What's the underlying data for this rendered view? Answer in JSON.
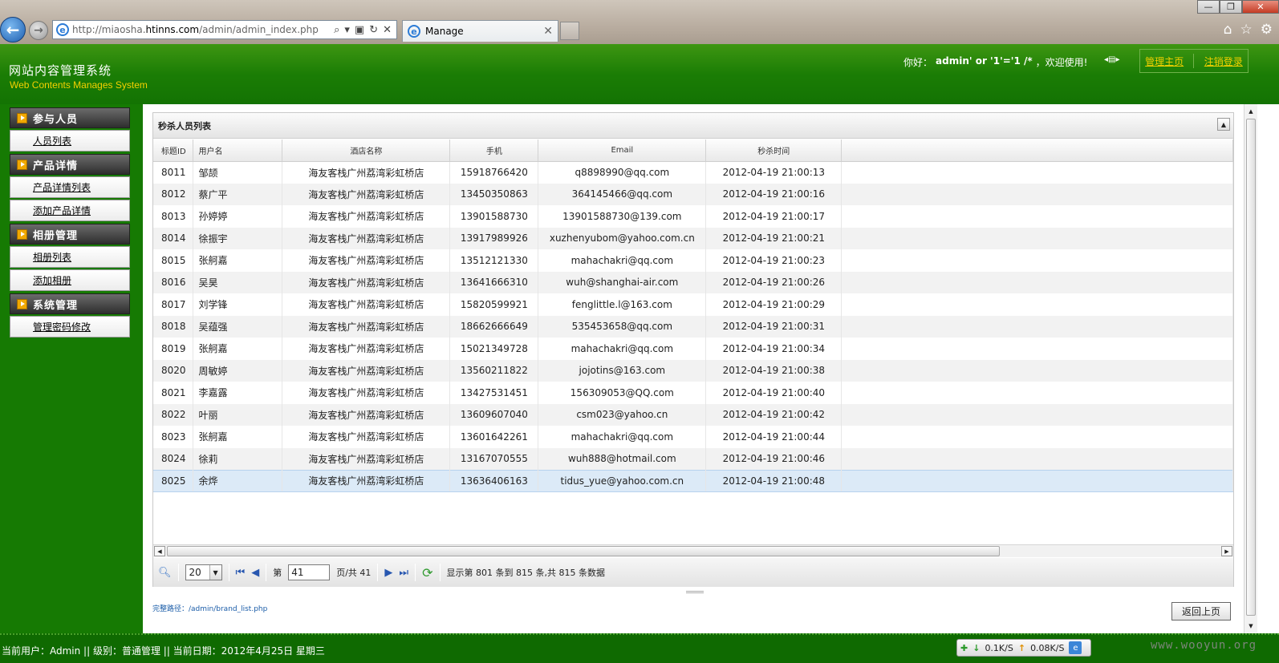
{
  "browser": {
    "url_prefix": "http://miaosha.",
    "url_domain": "htinns.com",
    "url_path": "/admin/admin_index.php",
    "tab_title": "Manage",
    "window_controls": [
      "—",
      "❐",
      "✕"
    ]
  },
  "header": {
    "title": "网站内容管理系统",
    "subtitle": "Web Contents Manages System",
    "greeting": "你好：",
    "username": "admin' or '1'='1 /*",
    "welcome": "，欢迎使用!",
    "links": [
      "管理主页",
      "注销登录"
    ]
  },
  "sidebar": {
    "groups": [
      {
        "title": "参与人员",
        "items": [
          "人员列表"
        ]
      },
      {
        "title": "产品详情",
        "items": [
          "产品详情列表",
          "添加产品详情"
        ]
      },
      {
        "title": "相册管理",
        "items": [
          "相册列表",
          "添加相册"
        ]
      },
      {
        "title": "系统管理",
        "items": [
          "管理密码修改"
        ]
      }
    ]
  },
  "panel": {
    "title": "秒杀人员列表",
    "columns": [
      "标题ID",
      "用户名",
      "酒店名称",
      "手机",
      "Email",
      "秒杀时间"
    ],
    "rows": [
      [
        "8011",
        "邹颉",
        "海友客栈广州荔湾彩虹桥店",
        "15918766420",
        "q8898990@qq.com",
        "2012-04-19 21:00:13"
      ],
      [
        "8012",
        "蔡广平",
        "海友客栈广州荔湾彩虹桥店",
        "13450350863",
        "364145466@qq.com",
        "2012-04-19 21:00:16"
      ],
      [
        "8013",
        "孙婷婷",
        "海友客栈广州荔湾彩虹桥店",
        "13901588730",
        "13901588730@139.com",
        "2012-04-19 21:00:17"
      ],
      [
        "8014",
        "徐振宇",
        "海友客栈广州荔湾彩虹桥店",
        "13917989926",
        "xuzhenyubom@yahoo.com.cn",
        "2012-04-19 21:00:21"
      ],
      [
        "8015",
        "张舸嘉",
        "海友客栈广州荔湾彩虹桥店",
        "13512121330",
        "mahachakri@qq.com",
        "2012-04-19 21:00:23"
      ],
      [
        "8016",
        "吴昊",
        "海友客栈广州荔湾彩虹桥店",
        "13641666310",
        "wuh@shanghai-air.com",
        "2012-04-19 21:00:26"
      ],
      [
        "8017",
        "刘学锋",
        "海友客栈广州荔湾彩虹桥店",
        "15820599921",
        "fenglittle.l@163.com",
        "2012-04-19 21:00:29"
      ],
      [
        "8018",
        "吴蕴强",
        "海友客栈广州荔湾彩虹桥店",
        "18662666649",
        "535453658@qq.com",
        "2012-04-19 21:00:31"
      ],
      [
        "8019",
        "张舸嘉",
        "海友客栈广州荔湾彩虹桥店",
        "15021349728",
        "mahachakri@qq.com",
        "2012-04-19 21:00:34"
      ],
      [
        "8020",
        "周敏婷",
        "海友客栈广州荔湾彩虹桥店",
        "13560211822",
        "jojotins@163.com",
        "2012-04-19 21:00:38"
      ],
      [
        "8021",
        "李嘉露",
        "海友客栈广州荔湾彩虹桥店",
        "13427531451",
        "156309053@QQ.com",
        "2012-04-19 21:00:40"
      ],
      [
        "8022",
        "叶丽",
        "海友客栈广州荔湾彩虹桥店",
        "13609607040",
        "csm023@yahoo.cn",
        "2012-04-19 21:00:42"
      ],
      [
        "8023",
        "张舸嘉",
        "海友客栈广州荔湾彩虹桥店",
        "13601642261",
        "mahachakri@qq.com",
        "2012-04-19 21:00:44"
      ],
      [
        "8024",
        "徐莉",
        "海友客栈广州荔湾彩虹桥店",
        "13167070555",
        "wuh888@hotmail.com",
        "2012-04-19 21:00:46"
      ],
      [
        "8025",
        "余烨",
        "海友客栈广州荔湾彩虹桥店",
        "13636406163",
        "tidus_yue@yahoo.com.cn",
        "2012-04-19 21:00:48"
      ]
    ],
    "selected_row_index": 14
  },
  "pager": {
    "page_size": "20",
    "page_prefix": "第",
    "current_page": "41",
    "page_suffix": "页/共 41",
    "info": "显示第 801 条到 815 条,共 815 条数据"
  },
  "footer": {
    "path_label": "完整路径：/admin/brand_list.php",
    "back_button": "返回上页"
  },
  "statusbar": {
    "text": "当前用户：Admin || 级别：普通管理 || 当前日期：2012年4月25日 星期三",
    "download_speed": "0.1K/S",
    "upload_speed": "0.08K/S",
    "watermark": "www.wooyun.org"
  },
  "colors": {
    "header_green": "#1b7d05",
    "sidebar_green": "#167a03",
    "subtitle_yellow": "#f4d000",
    "selected_row": "#dceaf7"
  }
}
